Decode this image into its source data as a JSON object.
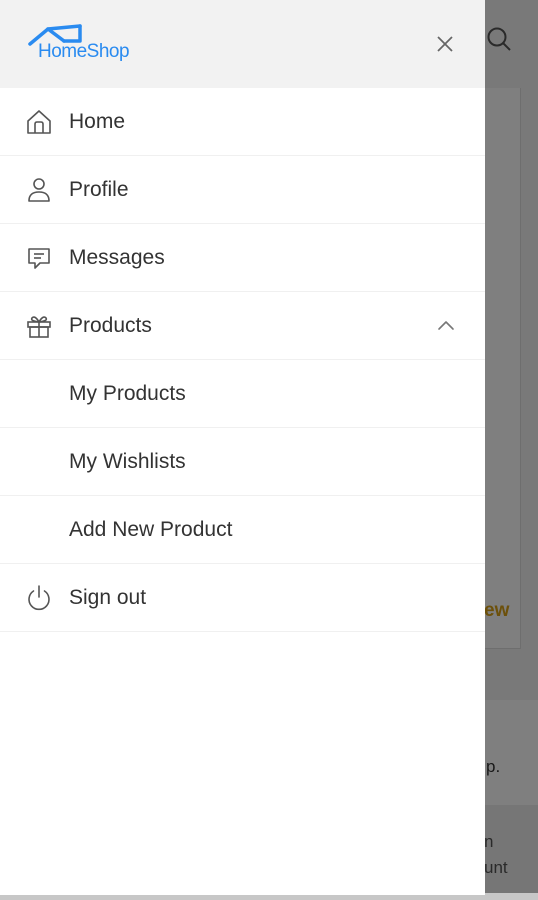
{
  "brand": {
    "name": "HomeShop",
    "color": "#2a8bf0"
  },
  "header": {
    "close_icon": "close-icon"
  },
  "menu": {
    "items": [
      {
        "label": "Home",
        "icon": "home-icon"
      },
      {
        "label": "Profile",
        "icon": "user-icon"
      },
      {
        "label": "Messages",
        "icon": "message-icon"
      },
      {
        "label": "Products",
        "icon": "gift-icon",
        "expanded": true,
        "chevron": "chevron-up-icon"
      }
    ],
    "submenu": [
      {
        "label": "My Products"
      },
      {
        "label": "My Wishlists"
      },
      {
        "label": "Add New Product"
      }
    ],
    "signout": {
      "label": "Sign out",
      "icon": "power-icon"
    }
  },
  "background": {
    "search_icon": "search-icon",
    "card_link_fragment": "ew",
    "panel_text_fragment": "p.",
    "footer_line_1": "n",
    "footer_line_2": "unt",
    "accent": "#d8a015"
  }
}
